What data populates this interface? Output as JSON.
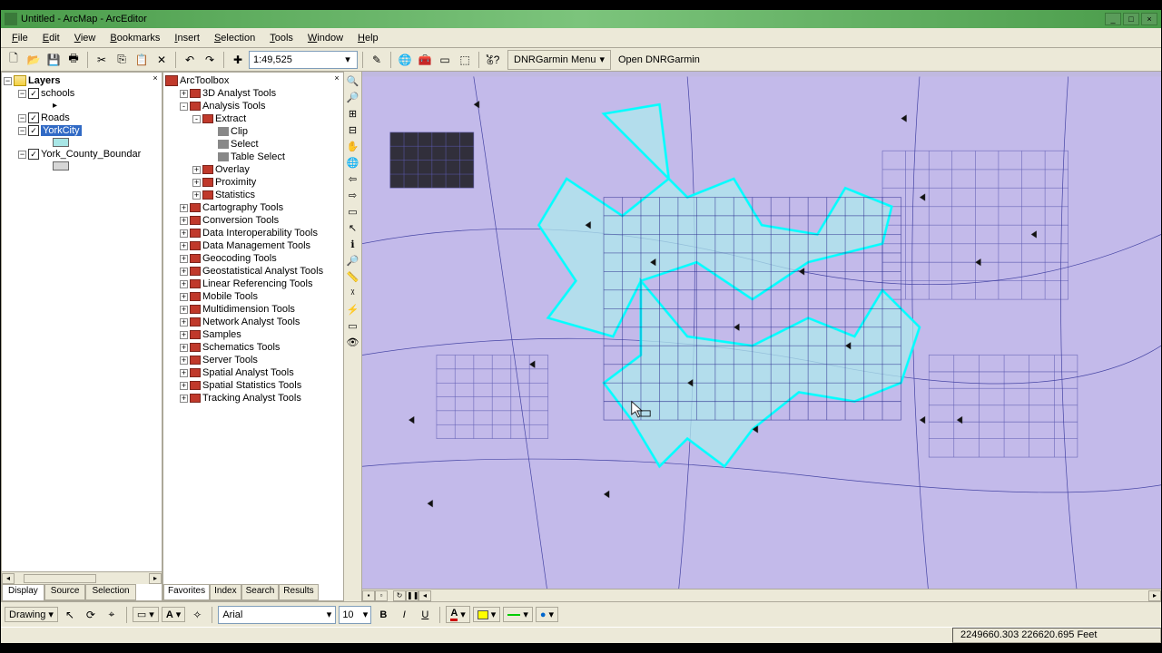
{
  "titlebar": {
    "title": "Untitled - ArcMap - ArcEditor"
  },
  "menubar": [
    "File",
    "Edit",
    "View",
    "Bookmarks",
    "Insert",
    "Selection",
    "Tools",
    "Window",
    "Help"
  ],
  "toolbar": {
    "scale": "1:49,525",
    "dnr_menu": "DNRGarmin Menu",
    "open_dnr": "Open DNRGarmin"
  },
  "toc": {
    "root": "Layers",
    "layers": [
      {
        "name": "schools",
        "checked": true,
        "symbol": "point"
      },
      {
        "name": "Roads",
        "checked": true,
        "symbol": "line"
      },
      {
        "name": "YorkCity",
        "checked": true,
        "selected": true,
        "symbol": "poly-cyan",
        "swatch": "#a8e6e6"
      },
      {
        "name": "York_County_Boundar",
        "checked": true,
        "symbol": "poly-gray",
        "swatch": "#d6d6d6"
      }
    ],
    "tabs": {
      "display": "Display",
      "source": "Source",
      "selection": "Selection"
    }
  },
  "toolbox": {
    "root": "ArcToolbox",
    "items": [
      {
        "name": "3D Analyst Tools",
        "exp": "+"
      },
      {
        "name": "Analysis Tools",
        "exp": "-",
        "children": [
          {
            "name": "Extract",
            "exp": "-",
            "children": [
              {
                "name": "Clip",
                "tool": true
              },
              {
                "name": "Select",
                "tool": true
              },
              {
                "name": "Table Select",
                "tool": true
              }
            ]
          },
          {
            "name": "Overlay",
            "exp": "+"
          },
          {
            "name": "Proximity",
            "exp": "+"
          },
          {
            "name": "Statistics",
            "exp": "+"
          }
        ]
      },
      {
        "name": "Cartography Tools",
        "exp": "+"
      },
      {
        "name": "Conversion Tools",
        "exp": "+"
      },
      {
        "name": "Data Interoperability Tools",
        "exp": "+"
      },
      {
        "name": "Data Management Tools",
        "exp": "+"
      },
      {
        "name": "Geocoding Tools",
        "exp": "+"
      },
      {
        "name": "Geostatistical Analyst Tools",
        "exp": "+"
      },
      {
        "name": "Linear Referencing Tools",
        "exp": "+"
      },
      {
        "name": "Mobile Tools",
        "exp": "+"
      },
      {
        "name": "Multidimension Tools",
        "exp": "+"
      },
      {
        "name": "Network Analyst Tools",
        "exp": "+"
      },
      {
        "name": "Samples",
        "exp": "+"
      },
      {
        "name": "Schematics Tools",
        "exp": "+"
      },
      {
        "name": "Server Tools",
        "exp": "+"
      },
      {
        "name": "Spatial Analyst Tools",
        "exp": "+"
      },
      {
        "name": "Spatial Statistics Tools",
        "exp": "+"
      },
      {
        "name": "Tracking Analyst Tools",
        "exp": "+"
      }
    ],
    "tabs": {
      "favorites": "Favorites",
      "index": "Index",
      "search": "Search",
      "results": "Results"
    }
  },
  "map_tools": [
    "zoom-in-icon",
    "zoom-out-icon",
    "fixed-zoom-in-icon",
    "fixed-zoom-out-icon",
    "pan-icon",
    "full-extent-icon",
    "back-icon",
    "forward-icon",
    "select-features-icon",
    "select-element-icon",
    "identify-icon",
    "find-icon",
    "measure-icon",
    "go-to-xy-icon",
    "hyperlink-icon",
    "html-popup-icon",
    "viewer-icon"
  ],
  "drawing": {
    "label": "Drawing",
    "font": "Arial",
    "size": "10"
  },
  "status": {
    "coords": "2249660.303 226620.695 Feet"
  }
}
